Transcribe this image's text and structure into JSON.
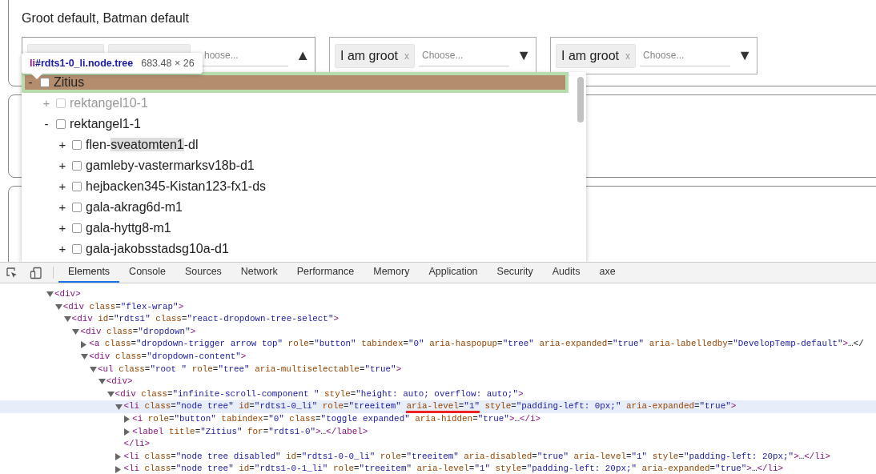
{
  "page": {
    "title": "Groot default, Batman default",
    "dropdowns": [
      {
        "tags": [
          {
            "kind": "covered"
          },
          {
            "kind": "covered"
          }
        ],
        "placeholder": "hoose...",
        "arrow": "▲",
        "open": true
      },
      {
        "tags": [
          {
            "kind": "chip",
            "label": "I am groot",
            "remove": "x"
          }
        ],
        "placeholder": "Choose...",
        "arrow": "▼",
        "open": false
      },
      {
        "tags": [
          {
            "kind": "chip",
            "label": "I am groot",
            "remove": "x"
          }
        ],
        "placeholder": "Choose...",
        "arrow": "▼",
        "open": false
      }
    ],
    "tree": [
      {
        "toggle": "-",
        "label": [
          {
            "text": "Zitius",
            "highlighted": false
          }
        ],
        "checked": false,
        "disabled": false,
        "inspected": true,
        "children": [
          {
            "toggle": "+",
            "label": [
              {
                "text": "rektangel10-1",
                "highlighted": false
              }
            ],
            "checked": false,
            "disabled": true,
            "inspected": false
          },
          {
            "toggle": "-",
            "label": [
              {
                "text": "rektangel1-1",
                "highlighted": false
              }
            ],
            "checked": false,
            "disabled": false,
            "inspected": false,
            "children": [
              {
                "toggle": "+",
                "label": [
                  {
                    "text": "flen-",
                    "highlighted": false
                  },
                  {
                    "text": "sveatomten1",
                    "highlighted": true
                  },
                  {
                    "text": "-dl",
                    "highlighted": false
                  }
                ],
                "checked": false,
                "disabled": false,
                "inspected": false
              },
              {
                "toggle": "+",
                "label": [
                  {
                    "text": "gamleby-vastermarksv18b-d1",
                    "highlighted": false
                  }
                ],
                "checked": false,
                "disabled": false,
                "inspected": false
              },
              {
                "toggle": "+",
                "label": [
                  {
                    "text": "hejbacken345-Kistan123-fx1-ds",
                    "highlighted": false
                  }
                ],
                "checked": false,
                "disabled": false,
                "inspected": false
              },
              {
                "toggle": "+",
                "label": [
                  {
                    "text": "gala-akrag6d-m1",
                    "highlighted": false
                  }
                ],
                "checked": false,
                "disabled": false,
                "inspected": false
              },
              {
                "toggle": "+",
                "label": [
                  {
                    "text": "gala-hyttg8-m1",
                    "highlighted": false
                  }
                ],
                "checked": false,
                "disabled": false,
                "inspected": false
              },
              {
                "toggle": "+",
                "label": [
                  {
                    "text": "gala-jakobsstadsg10a-d1",
                    "highlighted": false
                  }
                ],
                "checked": false,
                "disabled": false,
                "inspected": false
              }
            ]
          }
        ]
      }
    ],
    "inspect_tooltip": {
      "tag": "li",
      "selector": "#rdts1-0_li.node.tree",
      "size": "683.48 × 26"
    }
  },
  "devtools": {
    "tabs": [
      {
        "label": "Elements",
        "selected": true
      },
      {
        "label": "Console",
        "selected": false
      },
      {
        "label": "Sources",
        "selected": false
      },
      {
        "label": "Network",
        "selected": false
      },
      {
        "label": "Performance",
        "selected": false
      },
      {
        "label": "Memory",
        "selected": false
      },
      {
        "label": "Application",
        "selected": false
      },
      {
        "label": "Security",
        "selected": false
      },
      {
        "label": "Audits",
        "selected": false
      },
      {
        "label": "axe",
        "selected": false
      }
    ],
    "elements": [
      {
        "kind": "node",
        "expanded": true,
        "selected": false,
        "segments": [
          {
            "text": "<div>",
            "underlined": false
          }
        ],
        "children": [
          {
            "kind": "node",
            "expanded": true,
            "selected": false,
            "segments": [
              {
                "text": "<div class=\"flex-wrap\">",
                "underlined": false
              }
            ],
            "children": [
              {
                "kind": "node",
                "expanded": true,
                "selected": false,
                "segments": [
                  {
                    "text": "<div id=\"rdts1\" class=\"react-dropdown-tree-select\">",
                    "underlined": false
                  }
                ],
                "children": [
                  {
                    "kind": "node",
                    "expanded": true,
                    "selected": false,
                    "segments": [
                      {
                        "text": "<div class=\"dropdown\">",
                        "underlined": false
                      }
                    ],
                    "children": [
                      {
                        "kind": "node",
                        "expanded": false,
                        "selected": false,
                        "segments": [
                          {
                            "text": "<a class=\"dropdown-trigger arrow top\" role=\"button\" tabindex=\"0\" aria-haspopup=\"tree\" aria-expanded=\"true\" aria-labelledby=\"DevelopTemp-default\">…</",
                            "underlined": false
                          }
                        ]
                      },
                      {
                        "kind": "node",
                        "expanded": true,
                        "selected": false,
                        "segments": [
                          {
                            "text": "<div class=\"dropdown-content\">",
                            "underlined": false
                          }
                        ],
                        "children": [
                          {
                            "kind": "node",
                            "expanded": true,
                            "selected": false,
                            "segments": [
                              {
                                "text": "<ul class=\"root \" role=\"tree\" aria-multiselectable=\"true\">",
                                "underlined": false
                              }
                            ],
                            "children": [
                              {
                                "kind": "node",
                                "expanded": true,
                                "selected": false,
                                "segments": [
                                  {
                                    "text": "<div>",
                                    "underlined": false
                                  }
                                ],
                                "children": [
                                  {
                                    "kind": "node",
                                    "expanded": true,
                                    "selected": false,
                                    "segments": [
                                      {
                                        "text": "<div class=\"infinite-scroll-component \" style=\"height: auto; overflow: auto;\">",
                                        "underlined": false
                                      }
                                    ],
                                    "children": [
                                      {
                                        "kind": "node",
                                        "expanded": true,
                                        "selected": true,
                                        "segments": [
                                          {
                                            "text": "<li class=\"node tree\" id=\"rdts1-0_li\" role=\"treeitem\" ",
                                            "underlined": false
                                          },
                                          {
                                            "text": "aria-level=\"1\"",
                                            "underlined": true
                                          },
                                          {
                                            "text": " style=\"padding-left: 0px;\" aria-expanded=\"true\">",
                                            "underlined": false
                                          }
                                        ],
                                        "children": [
                                          {
                                            "kind": "node",
                                            "expanded": false,
                                            "selected": false,
                                            "segments": [
                                              {
                                                "text": "<i role=\"button\" tabindex=\"0\" class=\"toggle expanded\" aria-hidden=\"true\">…</i>",
                                                "underlined": false
                                              }
                                            ]
                                          },
                                          {
                                            "kind": "node",
                                            "expanded": false,
                                            "selected": false,
                                            "segments": [
                                              {
                                                "text": "<label title=\"Zitius\" for=\"rdts1-0\">…</label>",
                                                "underlined": false
                                              }
                                            ]
                                          }
                                        ]
                                      },
                                      {
                                        "kind": "close",
                                        "selected": false,
                                        "segments": [
                                          {
                                            "text": "</li>",
                                            "underlined": false
                                          }
                                        ]
                                      },
                                      {
                                        "kind": "node",
                                        "expanded": false,
                                        "selected": false,
                                        "segments": [
                                          {
                                            "text": "<li class=\"node tree disabled\" id=\"rdts1-0-0_li\" role=\"treeitem\" aria-disabled=\"true\" aria-level=\"1\" style=\"padding-left: 20px;\">…</li>",
                                            "underlined": false
                                          }
                                        ]
                                      },
                                      {
                                        "kind": "node",
                                        "expanded": false,
                                        "selected": false,
                                        "segments": [
                                          {
                                            "text": "<li class=\"node tree\" id=\"rdts1-0-1_li\" role=\"treeitem\" aria-level=\"1\" style=\"padding-left: 20px;\" aria-expanded=\"true\">…</li>",
                                            "underlined": false
                                          }
                                        ]
                                      }
                                    ]
                                  }
                                ]
                              }
                            ]
                          }
                        ]
                      }
                    ]
                  }
                ]
              }
            ]
          }
        ]
      }
    ]
  }
}
